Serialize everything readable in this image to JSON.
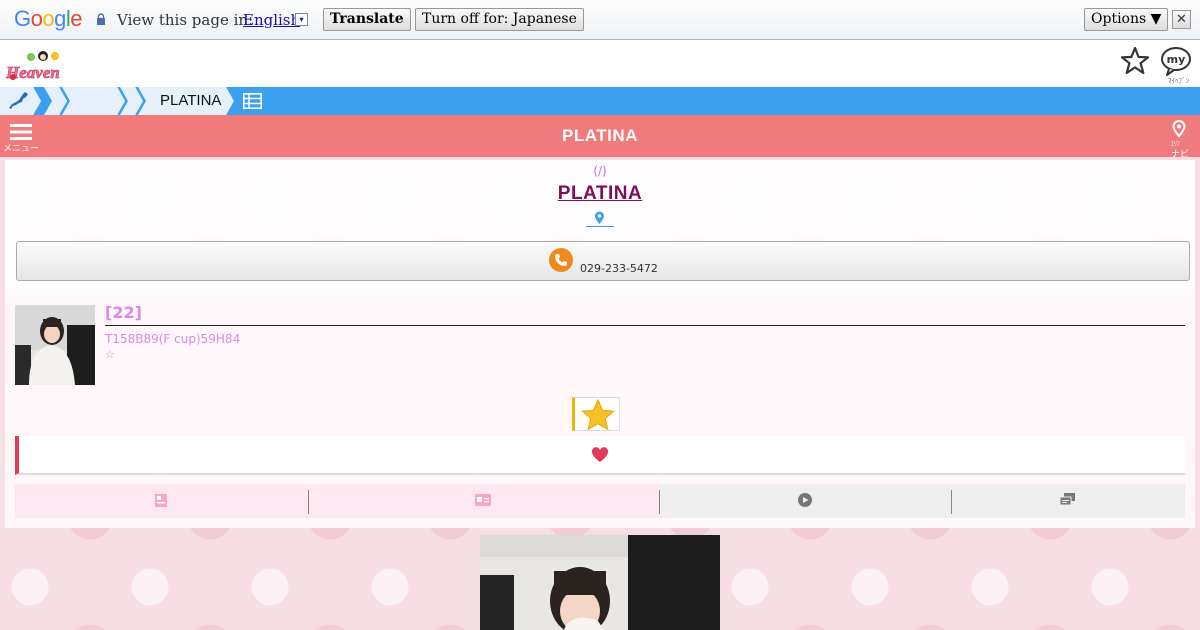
{
  "translate_bar": {
    "logo": "Google",
    "view_text": "View this page in:",
    "language": "English",
    "dropdown_glyph": "▾",
    "translate_label": "Translate",
    "turn_off_label": "Turn off for: Japanese",
    "options_label": "Options ▼",
    "close_glyph": "✕"
  },
  "header": {
    "logo_text": "Heaven",
    "favorite_icon": "star-outline-icon",
    "my_label": "my",
    "my_caption": "ﾏｲﾍﾌﾞﾝ"
  },
  "breadcrumb": {
    "home_icon": "japan-map-icon",
    "current": "PLATINA",
    "list_icon": "list-icon"
  },
  "nav_bar": {
    "menu_caption": "メニュー",
    "title": "PLATINA",
    "navi_caption_top": "ｴﾘｱ",
    "navi_caption": "ナビ",
    "color": "#f07a7c"
  },
  "shop": {
    "area_paren": "(/)",
    "name": "PLATINA",
    "phone": "029-233-5472"
  },
  "profile": {
    "age": "[22]",
    "specs": "T158B89(F cup)59H84",
    "rating": "☆",
    "age_color": "#d98ae6"
  },
  "tabs": [
    {
      "icon": "profile-card-icon"
    },
    {
      "icon": "id-card-icon"
    },
    {
      "icon": "play-icon"
    },
    {
      "icon": "messages-icon"
    }
  ],
  "colors": {
    "accent_blue": "#3ba1ef",
    "brand_pink": "#f07a7c",
    "heart": "#e23a5a",
    "star": "#f7c028",
    "shop_name": "#7d0f5a"
  }
}
